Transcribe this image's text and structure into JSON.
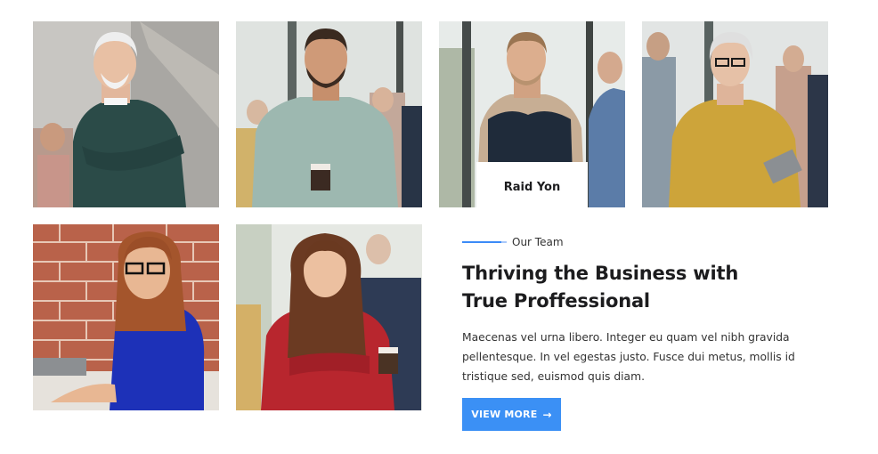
{
  "team": {
    "members": [
      {
        "alt": "Elderly man in green sweater with arms crossed",
        "icon": "photo-icon"
      },
      {
        "alt": "Bearded man in teal shirt holding coffee cup",
        "icon": "photo-icon"
      },
      {
        "alt": "Man in navy vest smiling",
        "icon": "photo-icon"
      },
      {
        "alt": "Senior woman in mustard sweater holding tablet",
        "icon": "photo-icon"
      },
      {
        "alt": "Woman with glasses in blue top at desk",
        "icon": "photo-icon"
      },
      {
        "alt": "Woman in red top holding coffee cup",
        "icon": "photo-icon"
      }
    ],
    "featured_name": "Raid Yon"
  },
  "section": {
    "eyebrow": "Our Team",
    "headline": "Thriving the Business with True Proffessional",
    "body": "Maecenas vel urna libero. Integer eu quam vel nibh gravida pellentesque. In vel egestas justo. Fusce dui metus, mollis id tristique sed, euismod quis diam.",
    "cta_label": "VIEW MORE",
    "cta_icon": "arrow-right-icon"
  },
  "colors": {
    "accent": "#3b90f5",
    "heading": "#1c1c1e",
    "text": "#333333"
  }
}
